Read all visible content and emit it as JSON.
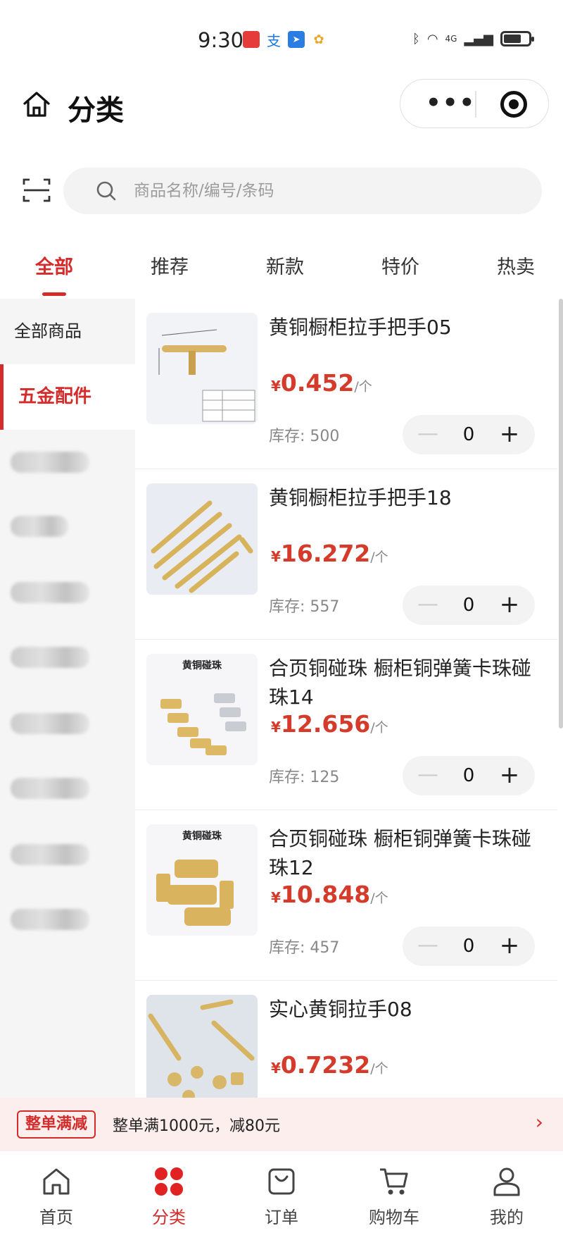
{
  "status_bar": {
    "time": "9:30",
    "network_label": "4G",
    "battery_level": 0.7
  },
  "header": {
    "title": "分类"
  },
  "search": {
    "placeholder": "商品名称/编号/条码"
  },
  "tabs": [
    {
      "label": "全部",
      "active": true
    },
    {
      "label": "推荐",
      "active": false
    },
    {
      "label": "新款",
      "active": false
    },
    {
      "label": "特价",
      "active": false
    },
    {
      "label": "热卖",
      "active": false
    }
  ],
  "sidebar": {
    "items": [
      {
        "label": "全部商品",
        "active": false
      },
      {
        "label": "五金配件",
        "active": true
      }
    ]
  },
  "products": [
    {
      "name": "黄铜橱柜拉手把手05",
      "currency": "¥",
      "price": "0.452",
      "unit": "/个",
      "stock_label": "库存:",
      "stock": "500",
      "quantity": "0",
      "thumb_text": ""
    },
    {
      "name": "黄铜橱柜拉手把手18",
      "currency": "¥",
      "price": "16.272",
      "unit": "/个",
      "stock_label": "库存:",
      "stock": "557",
      "quantity": "0",
      "thumb_text": ""
    },
    {
      "name": "合页铜碰珠 橱柜铜弹簧卡珠碰珠14",
      "currency": "¥",
      "price": "12.656",
      "unit": "/个",
      "stock_label": "库存:",
      "stock": "125",
      "quantity": "0",
      "thumb_text": "黄铜碰珠"
    },
    {
      "name": "合页铜碰珠 橱柜铜弹簧卡珠碰珠12",
      "currency": "¥",
      "price": "10.848",
      "unit": "/个",
      "stock_label": "库存:",
      "stock": "457",
      "quantity": "0",
      "thumb_text": "黄铜碰珠"
    },
    {
      "name": "实心黄铜拉手08",
      "currency": "¥",
      "price": "0.7232",
      "unit": "/个",
      "stock_label": "",
      "stock": "",
      "quantity": "",
      "thumb_text": ""
    }
  ],
  "promo": {
    "tag": "整单满减",
    "text": "整单满1000元，减80元",
    "arrow": "›"
  },
  "bottom_nav": [
    {
      "label": "首页",
      "icon": "home-icon",
      "active": false
    },
    {
      "label": "分类",
      "icon": "category-icon",
      "active": true
    },
    {
      "label": "订单",
      "icon": "order-bag-icon",
      "active": false
    },
    {
      "label": "购物车",
      "icon": "cart-icon",
      "active": false
    },
    {
      "label": "我的",
      "icon": "profile-icon",
      "active": false
    }
  ],
  "colors": {
    "accent": "#d42b2b",
    "price": "#d43b2b",
    "promo_bg": "#fdeeee"
  }
}
